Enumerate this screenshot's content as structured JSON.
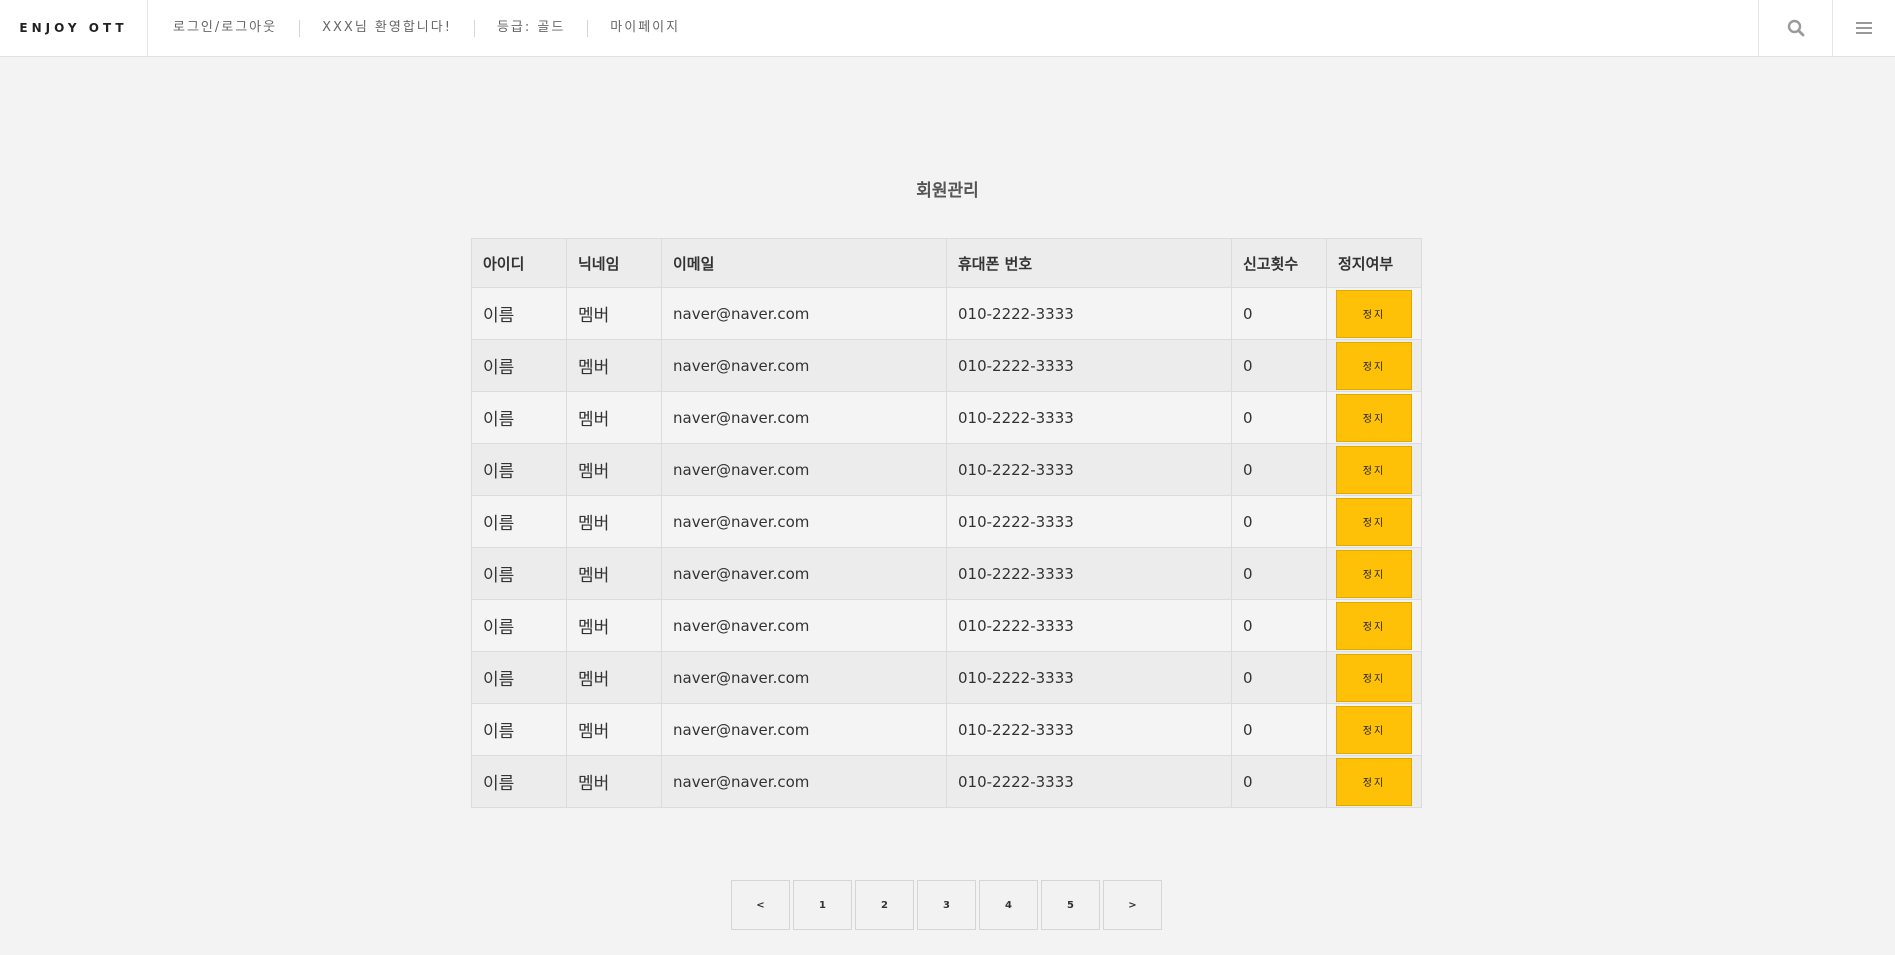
{
  "header": {
    "brand": "ENJOY OTT",
    "nav": [
      "로그인/로그아웃",
      "XXX님 환영합니다!",
      "등급: 골드",
      "마이페이지"
    ],
    "search_icon": "search-icon",
    "menu_icon": "hamburger-menu-icon"
  },
  "main": {
    "title": "회원관리"
  },
  "table": {
    "columns": [
      "아이디",
      "닉네임",
      "이메일",
      "휴대폰 번호",
      "신고횟수",
      "정지여부"
    ],
    "rows": [
      {
        "id": "이름",
        "nickname": "멤버",
        "email": "naver@naver.com",
        "phone": "010-2222-3333",
        "reports": "0",
        "action": "정지"
      },
      {
        "id": "이름",
        "nickname": "멤버",
        "email": "naver@naver.com",
        "phone": "010-2222-3333",
        "reports": "0",
        "action": "정지"
      },
      {
        "id": "이름",
        "nickname": "멤버",
        "email": "naver@naver.com",
        "phone": "010-2222-3333",
        "reports": "0",
        "action": "정지"
      },
      {
        "id": "이름",
        "nickname": "멤버",
        "email": "naver@naver.com",
        "phone": "010-2222-3333",
        "reports": "0",
        "action": "정지"
      },
      {
        "id": "이름",
        "nickname": "멤버",
        "email": "naver@naver.com",
        "phone": "010-2222-3333",
        "reports": "0",
        "action": "정지"
      },
      {
        "id": "이름",
        "nickname": "멤버",
        "email": "naver@naver.com",
        "phone": "010-2222-3333",
        "reports": "0",
        "action": "정지"
      },
      {
        "id": "이름",
        "nickname": "멤버",
        "email": "naver@naver.com",
        "phone": "010-2222-3333",
        "reports": "0",
        "action": "정지"
      },
      {
        "id": "이름",
        "nickname": "멤버",
        "email": "naver@naver.com",
        "phone": "010-2222-3333",
        "reports": "0",
        "action": "정지"
      },
      {
        "id": "이름",
        "nickname": "멤버",
        "email": "naver@naver.com",
        "phone": "010-2222-3333",
        "reports": "0",
        "action": "정지"
      },
      {
        "id": "이름",
        "nickname": "멤버",
        "email": "naver@naver.com",
        "phone": "010-2222-3333",
        "reports": "0",
        "action": "정지"
      }
    ]
  },
  "pagination": {
    "prev": "<",
    "pages": [
      "1",
      "2",
      "3",
      "4",
      "5"
    ],
    "next": ">"
  },
  "colors": {
    "background": "#f3f3f3",
    "header_bg": "#ffffff",
    "stop_button": "#ffc107"
  }
}
